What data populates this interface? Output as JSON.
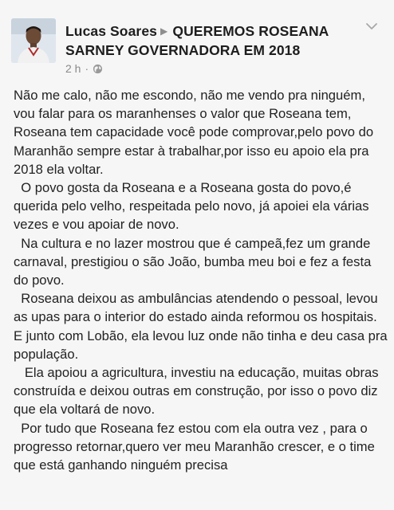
{
  "post": {
    "author": "Lucas Soares",
    "target_group": "QUEREMOS ROSEANA SARNEY GOVERNADORA EM 2018",
    "time": "2 h",
    "separator": "·",
    "privacy_icon": "globe-icon",
    "menu_icon": "chevron-down-icon",
    "paragraphs": [
      "Não me calo, não me escondo, não me vendo pra ninguém, vou falar para os maranhenses o valor que Roseana tem, Roseana tem capacidade você pode comprovar,pelo povo do Maranhão sempre estar à trabalhar,por isso eu apoio ela pra 2018 ela voltar.",
      "  O povo gosta da Roseana e a Roseana gosta do povo,é querida pelo velho, respeitada pelo novo, já apoiei ela várias vezes e vou apoiar de novo.",
      "  Na cultura e no lazer mostrou que é campeã,fez um grande carnaval, prestigiou o são João, bumba meu boi e fez a festa do povo.",
      "  Roseana deixou as ambulâncias atendendo o pessoal, levou as upas para o interior do estado ainda reformou os hospitais. E junto com Lobão, ela levou luz onde não tinha e deu casa pra população.",
      "   Ela apoiou a agricultura, investiu na educação, muitas obras construída e deixou outras em construção, por isso o povo diz que ela voltará de novo.",
      "  Por tudo que Roseana fez estou com ela outra vez , para o progresso retornar,quero ver meu Maranhão crescer, e o time que está ganhando ninguém precisa"
    ]
  }
}
